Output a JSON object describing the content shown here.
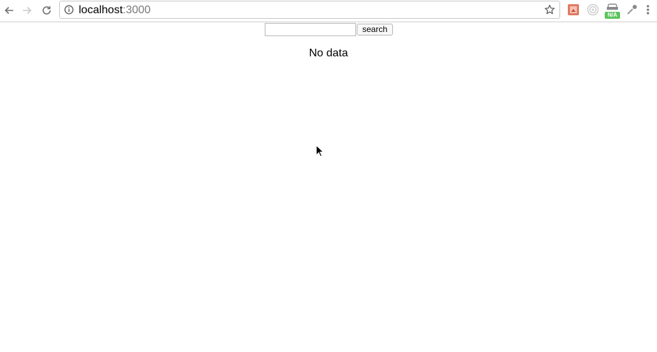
{
  "browser": {
    "url_host": "localhost",
    "url_port": ":3000",
    "extensions": [
      {
        "name": "extension-one",
        "color": "#e07a62"
      },
      {
        "name": "extension-target",
        "color": "#bdbdbd"
      },
      {
        "name": "extension-na",
        "badge": "N/A",
        "color": "#5cc35c"
      },
      {
        "name": "extension-dropper",
        "color": "#8a8a8a"
      }
    ]
  },
  "page": {
    "search_placeholder": "",
    "search_button_label": "search",
    "message": "No data"
  }
}
